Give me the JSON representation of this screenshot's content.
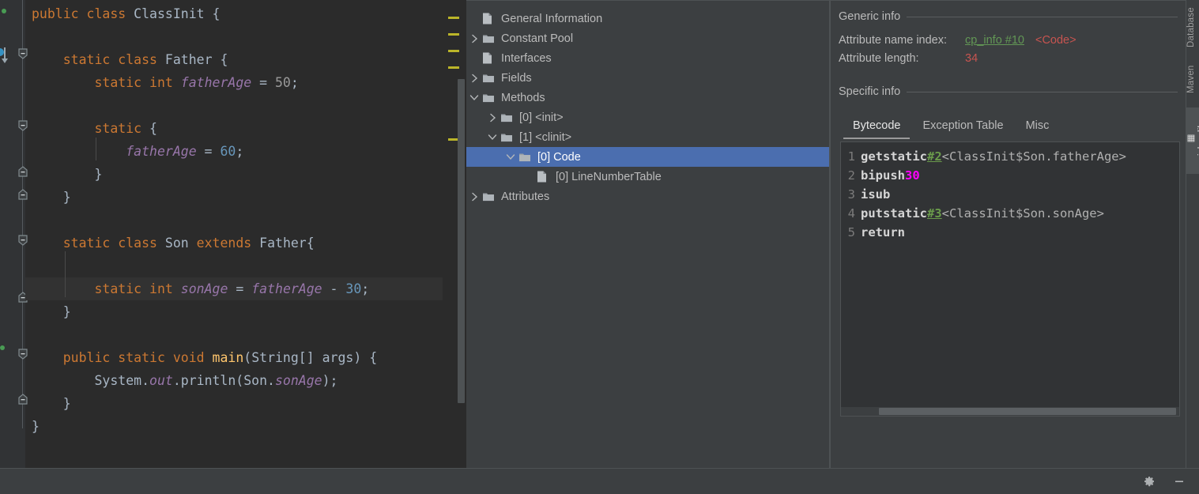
{
  "editor": {
    "lines": [
      [
        {
          "t": "public ",
          "c": "kw"
        },
        {
          "t": "class ",
          "c": "kw"
        },
        {
          "t": "ClassInit ",
          "c": "cls"
        },
        {
          "t": "{",
          "c": "pn"
        }
      ],
      [],
      [
        {
          "t": "    ",
          "c": "pn"
        },
        {
          "t": "static ",
          "c": "kw"
        },
        {
          "t": "class ",
          "c": "kw"
        },
        {
          "t": "Father ",
          "c": "cls"
        },
        {
          "t": "{",
          "c": "pn"
        }
      ],
      [
        {
          "t": "        ",
          "c": "pn"
        },
        {
          "t": "static ",
          "c": "kw"
        },
        {
          "t": "int ",
          "c": "kw"
        },
        {
          "t": "fatherAge",
          "c": "fld"
        },
        {
          "t": " = ",
          "c": "pn"
        },
        {
          "t": "50",
          "c": "numd"
        },
        {
          "t": ";",
          "c": "pn"
        }
      ],
      [],
      [
        {
          "t": "        ",
          "c": "pn"
        },
        {
          "t": "static ",
          "c": "kw"
        },
        {
          "t": "{",
          "c": "pn"
        }
      ],
      [
        {
          "t": "            ",
          "c": "pn"
        },
        {
          "t": "fatherAge",
          "c": "fld"
        },
        {
          "t": " = ",
          "c": "pn"
        },
        {
          "t": "60",
          "c": "num"
        },
        {
          "t": ";",
          "c": "pn"
        }
      ],
      [
        {
          "t": "        }",
          "c": "pn"
        }
      ],
      [
        {
          "t": "    }",
          "c": "pn"
        }
      ],
      [],
      [
        {
          "t": "    ",
          "c": "pn"
        },
        {
          "t": "static ",
          "c": "kw"
        },
        {
          "t": "class ",
          "c": "kw"
        },
        {
          "t": "Son ",
          "c": "cls"
        },
        {
          "t": "extends ",
          "c": "kw"
        },
        {
          "t": "Father",
          "c": "cls"
        },
        {
          "t": "{",
          "c": "pn"
        }
      ],
      [],
      [
        {
          "t": "        ",
          "c": "pn"
        },
        {
          "t": "static ",
          "c": "kw"
        },
        {
          "t": "int ",
          "c": "kw"
        },
        {
          "t": "sonAge",
          "c": "fld"
        },
        {
          "t": " = ",
          "c": "pn"
        },
        {
          "t": "fatherAge",
          "c": "fld"
        },
        {
          "t": " - ",
          "c": "pn"
        },
        {
          "t": "30",
          "c": "num"
        },
        {
          "t": ";",
          "c": "pn"
        }
      ],
      [
        {
          "t": "    }",
          "c": "pn"
        }
      ],
      [],
      [
        {
          "t": "    ",
          "c": "pn"
        },
        {
          "t": "public ",
          "c": "kw"
        },
        {
          "t": "static ",
          "c": "kw"
        },
        {
          "t": "void ",
          "c": "kw"
        },
        {
          "t": "main",
          "c": "mth"
        },
        {
          "t": "(String[] args) {",
          "c": "pn"
        }
      ],
      [
        {
          "t": "        System.",
          "c": "pn"
        },
        {
          "t": "out",
          "c": "fld"
        },
        {
          "t": ".println(Son.",
          "c": "pn"
        },
        {
          "t": "sonAge",
          "c": "fld"
        },
        {
          "t": ");",
          "c": "pn"
        }
      ],
      [
        {
          "t": "    }",
          "c": "pn"
        }
      ],
      [
        {
          "t": "}",
          "c": "pn"
        }
      ]
    ],
    "highlighted_line_index": 12,
    "warning_marker_count": 5
  },
  "tree": {
    "nodes": [
      {
        "label": "General Information",
        "depth": 1,
        "arrow": "none",
        "icon": "file-icon",
        "selected": false
      },
      {
        "label": "Constant Pool",
        "depth": 1,
        "arrow": "chevron-right-icon",
        "icon": "folder-icon",
        "selected": false
      },
      {
        "label": "Interfaces",
        "depth": 1,
        "arrow": "none",
        "icon": "file-icon",
        "selected": false
      },
      {
        "label": "Fields",
        "depth": 1,
        "arrow": "chevron-right-icon",
        "icon": "folder-icon",
        "selected": false
      },
      {
        "label": "Methods",
        "depth": 1,
        "arrow": "chevron-down-icon",
        "icon": "folder-icon",
        "selected": false
      },
      {
        "label": "[0] <init>",
        "depth": 2,
        "arrow": "chevron-right-icon",
        "icon": "folder-icon",
        "selected": false
      },
      {
        "label": "[1] <clinit>",
        "depth": 2,
        "arrow": "chevron-down-icon",
        "icon": "folder-icon",
        "selected": false
      },
      {
        "label": "[0] Code",
        "depth": 3,
        "arrow": "chevron-down-icon",
        "icon": "folder-icon",
        "selected": true
      },
      {
        "label": "[0] LineNumberTable",
        "depth": 4,
        "arrow": "none",
        "icon": "file-icon",
        "selected": false
      },
      {
        "label": "Attributes",
        "depth": 1,
        "arrow": "chevron-right-icon",
        "icon": "folder-icon",
        "selected": false
      }
    ]
  },
  "detail": {
    "generic_info_title": "Generic info",
    "attribute_name_index_label": "Attribute name index:",
    "attribute_name_index_link": "cp_info #10",
    "attribute_name_index_value": "<Code>",
    "attribute_length_label": "Attribute length:",
    "attribute_length_value": "34",
    "specific_info_title": "Specific info",
    "tabs": [
      {
        "label": "Bytecode",
        "active": true
      },
      {
        "label": "Exception Table",
        "active": false
      },
      {
        "label": "Misc",
        "active": false
      }
    ],
    "bytecode": [
      {
        "n": "1",
        "op": "getstatic",
        "cp": "#2",
        "ref": "<ClassInit$Son.fatherAge>",
        "lit": ""
      },
      {
        "n": "2",
        "op": "bipush",
        "cp": "",
        "ref": "",
        "lit": "30"
      },
      {
        "n": "3",
        "op": "isub",
        "cp": "",
        "ref": "",
        "lit": ""
      },
      {
        "n": "4",
        "op": "putstatic",
        "cp": "#3",
        "ref": "<ClassInit$Son.sonAge>",
        "lit": ""
      },
      {
        "n": "5",
        "op": "return",
        "cp": "",
        "ref": "",
        "lit": ""
      }
    ]
  },
  "right_strip": {
    "tabs": [
      {
        "label": "Database",
        "selected": false
      },
      {
        "label": "Maven",
        "selected": false
      },
      {
        "label": "jclasslib",
        "selected": true
      }
    ]
  },
  "statusbar": {
    "settings_label": "gear-icon",
    "minimize_label": "minimize-icon"
  },
  "colors": {
    "accent_selection": "#4b6eaf",
    "editor_bg": "#2b2b2b",
    "panel_bg": "#3c3f41",
    "keyword": "#cc7832",
    "number": "#6897bb",
    "field": "#9876aa",
    "method": "#ffc66d",
    "link_green": "#629755",
    "value_red": "#c75450",
    "literal_magenta": "#ff00ff",
    "warning_marker": "#bbb529"
  }
}
